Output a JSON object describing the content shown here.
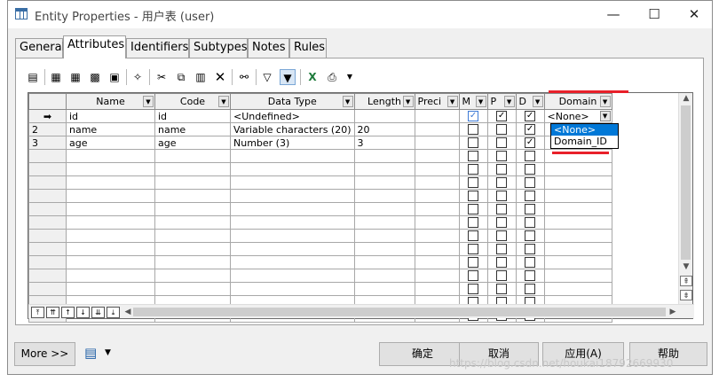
{
  "window": {
    "title": "Entity Properties - 用户表 (user)",
    "controls": [
      "minimize-icon",
      "maximize-icon",
      "close-icon"
    ]
  },
  "tabs": [
    "General",
    "Attributes",
    "Identifiers",
    "Subtypes",
    "Notes",
    "Rules"
  ],
  "active_tab": "Attributes",
  "toolbar_icons": [
    "properties-icon",
    "add-row-icon",
    "insert-row-icon",
    "add-attributes-icon",
    "replicate-icon",
    "new-icon",
    "cut-icon",
    "copy-icon",
    "paste-icon",
    "delete-icon",
    "find-icon",
    "filter-icon",
    "customize-columns-icon",
    "excel-export-icon",
    "print-icon",
    "dropdown-arrow-icon"
  ],
  "grid": {
    "columns": [
      "Name",
      "Code",
      "Data Type",
      "Length",
      "Preci",
      "M",
      "P",
      "D",
      "Domain"
    ],
    "rows": [
      {
        "marker": "➡",
        "name": "id",
        "code": "id",
        "data_type": "<Undefined>",
        "length": "",
        "preci": "",
        "m": true,
        "p": true,
        "d": true,
        "domain": "<None>"
      },
      {
        "marker": "2",
        "name": "name",
        "code": "name",
        "data_type": "Variable characters (20)",
        "length": "20",
        "preci": "",
        "m": false,
        "p": false,
        "d": true,
        "domain": ""
      },
      {
        "marker": "3",
        "name": "age",
        "code": "age",
        "data_type": "Number (3)",
        "length": "3",
        "preci": "",
        "m": false,
        "p": false,
        "d": true,
        "domain": ""
      }
    ],
    "empty_row_count": 13
  },
  "domain_dropdown": {
    "options": [
      "<None>",
      "Domain_ID"
    ],
    "selected": "<None>"
  },
  "nav_buttons": [
    "⤒",
    "⇈",
    "↑",
    "↓",
    "⇊",
    "⤓"
  ],
  "buttons": {
    "more": "More >>",
    "ok": "确定",
    "cancel": "取消",
    "apply": "应用(A)",
    "help": "帮助"
  },
  "watermark": "https://blog.csdn.net/houkai18792669930",
  "colors": {
    "annotation_red": "#e8202a",
    "selection_blue": "#0078d7"
  }
}
